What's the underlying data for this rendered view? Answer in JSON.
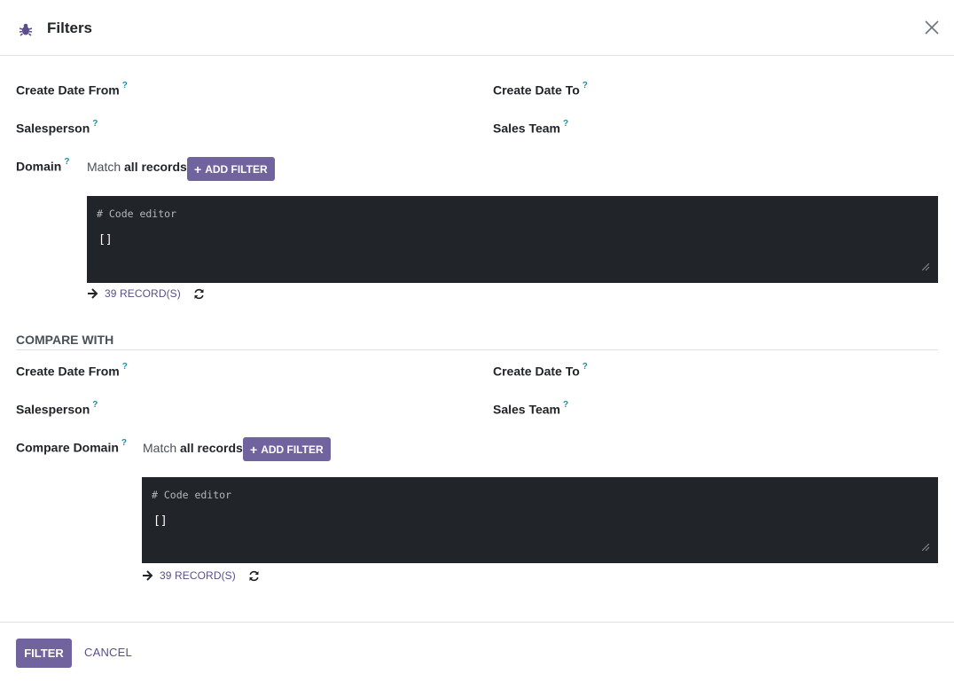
{
  "dialog": {
    "title": "Filters",
    "header_icon": "bug-icon",
    "close_icon": "close-icon"
  },
  "help_marker": "?",
  "filters": {
    "create_date_from": "Create Date From",
    "create_date_to": "Create Date To",
    "salesperson": "Salesperson",
    "sales_team": "Sales Team",
    "domain_label": "Domain",
    "match_prefix": "Match",
    "match_scope": "all records",
    "add_filter": "ADD FILTER",
    "editor_comment": "# Code editor",
    "editor_value": "[]",
    "records": "39 RECORD(S)"
  },
  "compare": {
    "section_title": "COMPARE WITH",
    "create_date_from": "Create Date From",
    "create_date_to": "Create Date To",
    "salesperson": "Salesperson",
    "sales_team": "Sales Team",
    "domain_label": "Compare Domain",
    "match_prefix": "Match",
    "match_scope": "all records",
    "add_filter": "ADD FILTER",
    "editor_comment": "# Code editor",
    "editor_value": "[]",
    "records": "39 RECORD(S)"
  },
  "footer": {
    "filter_button": "FILTER",
    "cancel_button": "CANCEL"
  },
  "colors": {
    "primary": "#71639e",
    "link": "#5b4e8a",
    "help": "#1a8fa6",
    "editor_bg": "#212529"
  }
}
